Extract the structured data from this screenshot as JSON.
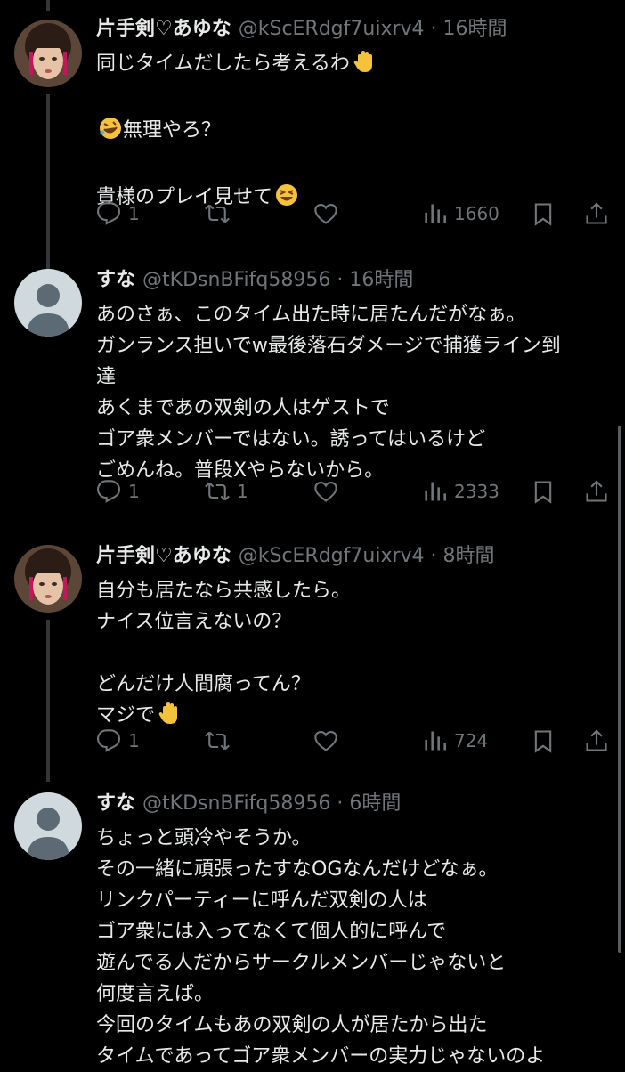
{
  "tweets": [
    {
      "name": "片手剣♡あゆな",
      "handle": "@kScERdgf7uixrv4",
      "time": "16時間",
      "lines": [
        "同じタイムだしたら考えるわ",
        "",
        "無理やろ？",
        "",
        "貴様のプレイ見せて"
      ],
      "replies": "1",
      "retweets": "",
      "views": "1660"
    },
    {
      "name": "すな",
      "handle": "@tKDsnBFifq58956",
      "time": "16時間",
      "lines": [
        "あのさぁ、このタイム出た時に居たんだがなぁ。",
        "ガンランス担いでw最後落石ダメージで捕獲ライン到",
        "達",
        "あくまであの双剣の人はゲストで",
        "ゴア衆メンバーではない。誘ってはいるけど",
        "ごめんね。普段Xやらないから。"
      ],
      "replies": "1",
      "retweets": "1",
      "views": "2333"
    },
    {
      "name": "片手剣♡あゆな",
      "handle": "@kScERdgf7uixrv4",
      "time": "8時間",
      "lines": [
        "自分も居たなら共感したら。",
        "ナイス位言えないの？",
        "",
        "どんだけ人間腐ってん？",
        "マジで"
      ],
      "replies": "1",
      "retweets": "",
      "views": "724"
    },
    {
      "name": "すな",
      "handle": "@tKDsnBFifq58956",
      "time": "6時間",
      "lines": [
        "ちょっと頭冷やそうか。",
        "その一緒に頑張ったすなOGなんだけどなぁ。",
        "リンクパーティーに呼んだ双剣の人は",
        "ゴア衆には入ってなくて個人的に呼んで",
        "遊んでる人だからサークルメンバーじゃないと",
        "何度言えば。",
        "今回のタイムもあの双剣の人が居たから出た",
        "タイムであってゴア衆メンバーの実力じゃないのよ"
      ],
      "replies": "",
      "retweets": "",
      "views": ""
    }
  ],
  "icons": [
    "reply-icon",
    "retweet-icon",
    "like-icon",
    "views-icon",
    "bookmark-icon",
    "share-icon",
    "raised-hand-emoji",
    "rolling-laughing-emoji",
    "grinning-squint-emoji"
  ],
  "colors": {
    "background": "#000000",
    "text": "#e7e9ea",
    "secondary": "#71767b",
    "thread_line": "#333639"
  }
}
